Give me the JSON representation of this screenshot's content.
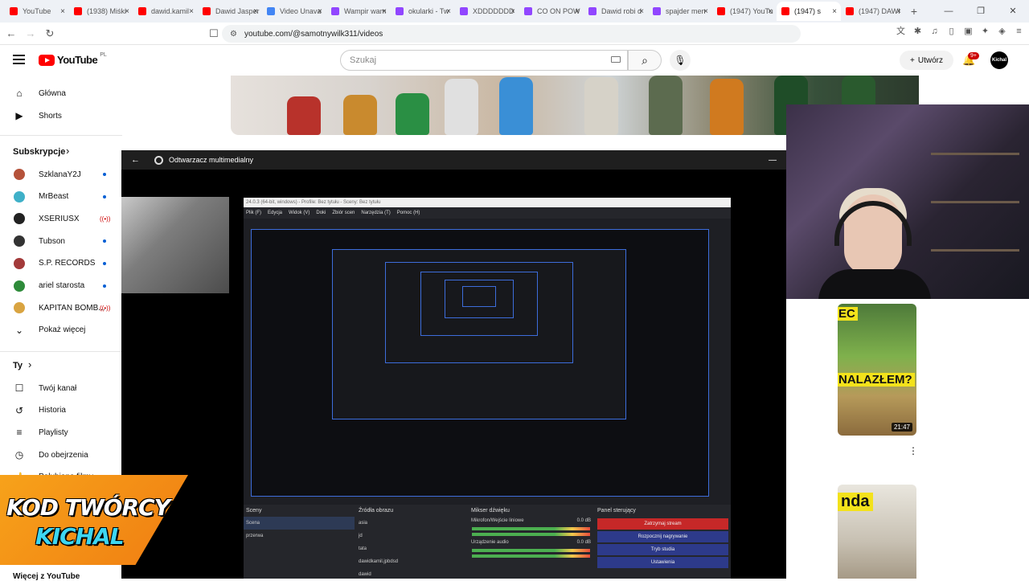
{
  "browser": {
    "tabs": [
      {
        "label": "YouTube",
        "color": "#ff0000"
      },
      {
        "label": "(1938) Miśki",
        "color": "#ff0000"
      },
      {
        "label": "dawid.kamil",
        "color": "#ff0000"
      },
      {
        "label": "Dawid Jasper",
        "color": "#ff0000"
      },
      {
        "label": "Video Unava",
        "color": "#4285f4"
      },
      {
        "label": "Wampir wam",
        "color": "#9146ff"
      },
      {
        "label": "okularki - Tw",
        "color": "#9146ff"
      },
      {
        "label": "XDDDDDDD",
        "color": "#9146ff"
      },
      {
        "label": "CO ON POW",
        "color": "#9146ff"
      },
      {
        "label": "Dawid robi d",
        "color": "#9146ff"
      },
      {
        "label": "spajder men",
        "color": "#9146ff"
      },
      {
        "label": "(1947) YouTu",
        "color": "#ff0000"
      },
      {
        "label": "(1947) s",
        "color": "#ff0000",
        "active": true
      },
      {
        "label": "(1947) DAWI",
        "color": "#ff0000"
      }
    ],
    "url": "youtube.com/@samotnywilk311/videos"
  },
  "header": {
    "logo_text": "YouTube",
    "country_code": "PL",
    "search_placeholder": "Szukaj",
    "create_label": "Utwórz",
    "notif_count": "9+",
    "avatar_text": "Kichal"
  },
  "sidebar": {
    "main": [
      {
        "label": "Główna",
        "icon": "home-icon",
        "glyph": "⌂"
      },
      {
        "label": "Shorts",
        "icon": "shorts-icon",
        "glyph": "▶"
      }
    ],
    "subs_heading": "Subskrypcje",
    "subs": [
      {
        "label": "SzklanaY2J",
        "color": "#b5523a",
        "status": "dot"
      },
      {
        "label": "MrBeast",
        "color": "#3fb0c8",
        "status": "dot"
      },
      {
        "label": "XSERIUSX",
        "color": "#222222",
        "status": "live"
      },
      {
        "label": "Tubson",
        "color": "#333333",
        "status": "dot"
      },
      {
        "label": "S.P. RECORDS",
        "color": "#a33a3a",
        "status": "dot"
      },
      {
        "label": "ariel starosta",
        "color": "#2e8b3a",
        "status": "dot"
      },
      {
        "label": "KAPITAN BOMB...",
        "color": "#d9a441",
        "status": "live"
      }
    ],
    "show_more": "Pokaż więcej",
    "you_heading": "Ty",
    "you": [
      {
        "label": "Twój kanał",
        "icon": "channel-icon",
        "glyph": "☐"
      },
      {
        "label": "Historia",
        "icon": "history-icon",
        "glyph": "↺"
      },
      {
        "label": "Playlisty",
        "icon": "playlist-icon",
        "glyph": "≡"
      },
      {
        "label": "Do obejrzenia",
        "icon": "watch-later-icon",
        "glyph": "◷"
      },
      {
        "label": "Polubione filmy",
        "icon": "like-icon",
        "glyph": "👍"
      }
    ],
    "more_heading": "Więcej z YouTube"
  },
  "player": {
    "title": "Odtwarzacz multimedialny",
    "obs_title": "24.0.3 (64-bit, windows) - Profile: Bez tytułu - Sceny: Bez tytułu",
    "obs_menu": [
      "Plik (F)",
      "Edycja",
      "Widok (V)",
      "Doki",
      "Zbiór scen",
      "Narzędzia (T)",
      "Pomoc (H)"
    ],
    "docks": {
      "scenes_title": "Sceny",
      "scenes": [
        "Scena",
        "przerwa"
      ],
      "sources_title": "Źródła obrazu",
      "sources": [
        "asia",
        "jd",
        "tata",
        "dawidkamil.jpbdsd",
        "dawid"
      ],
      "mixer_title": "Mikser dźwięku",
      "mixer": [
        {
          "name": "Mikrofon/Wejście liniowe",
          "level": "0.0 dB"
        },
        {
          "name": "Urządzenie audio",
          "level": "0.0 dB"
        }
      ],
      "controls_title": "Panel sterujący",
      "controls": [
        "Zatrzymaj stream",
        "Rozpocznij nagrywanie",
        "Tryb studia",
        "Ustawienia"
      ]
    }
  },
  "thumbs": {
    "t1_top": "EC",
    "t1_bottom": "NALAZŁEM?",
    "t1_duration": "21:47",
    "t2_title": "nda"
  },
  "creator_code": {
    "line1": "KOD TWÓRCY",
    "line2": "KICHAL"
  }
}
